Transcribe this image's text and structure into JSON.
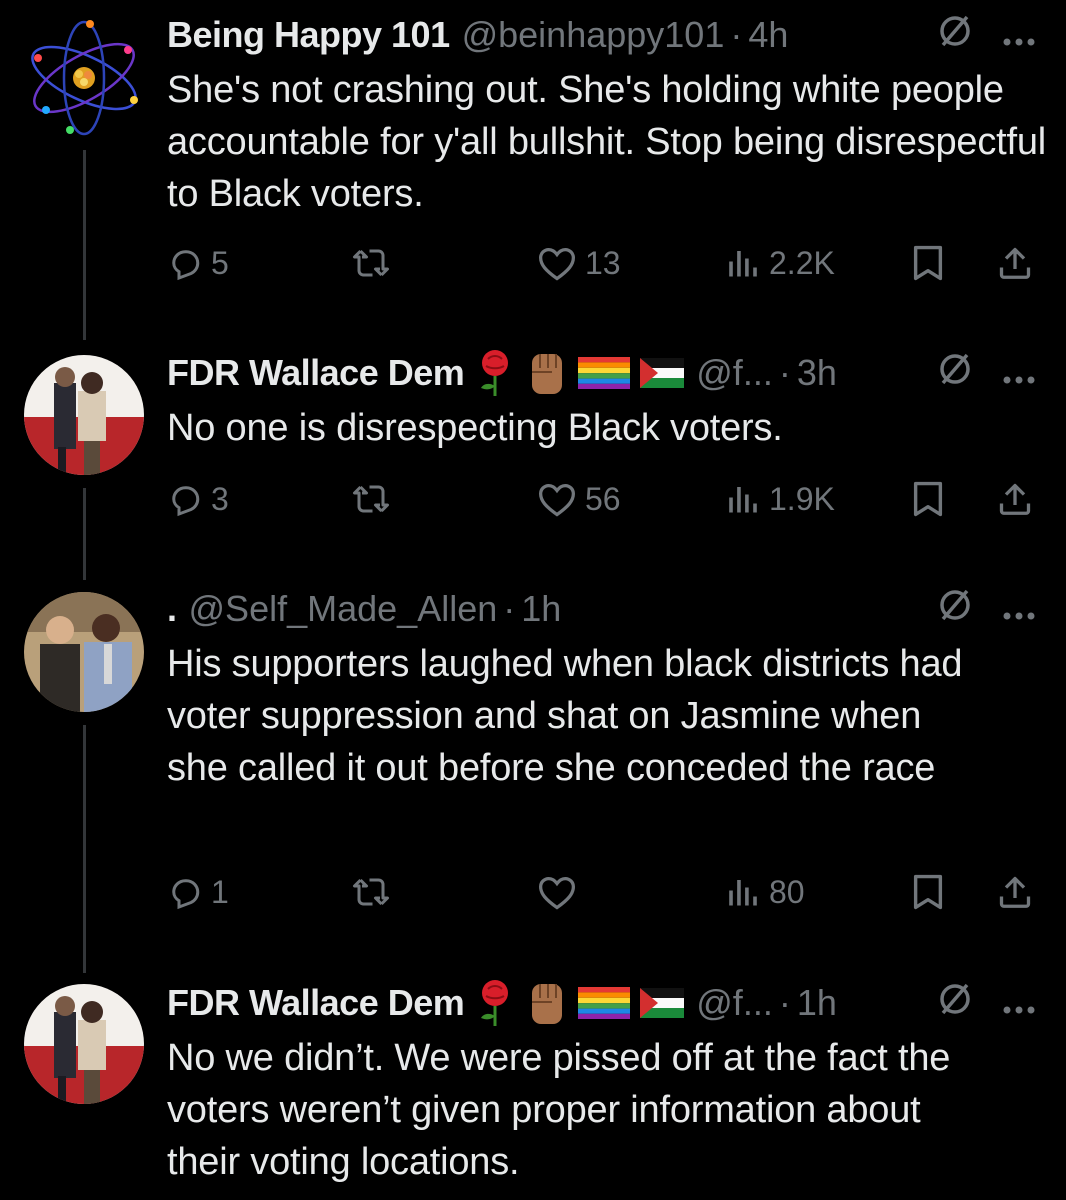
{
  "colors": {
    "background": "#000000",
    "text": "#e7e9ea",
    "muted": "#71767b",
    "thread_line": "#333639"
  },
  "tweets": [
    {
      "name": "Being Happy 101",
      "handle": "@beinhappy101",
      "dot": "·",
      "time": "4h",
      "text": "She's not crashing out. She's holding white people accountable for y'all bullshit. Stop being disrespectful to Black voters.",
      "replies": "5",
      "reposts": "",
      "likes": "13",
      "views": "2.2K",
      "emojis": []
    },
    {
      "name": "FDR Wallace Dem",
      "handle": "@f...",
      "dot": "·",
      "time": "3h",
      "text": "No one is disrespecting Black voters.",
      "replies": "3",
      "reposts": "",
      "likes": "56",
      "views": "1.9K",
      "emojis": [
        "rose-emoji",
        "raised-fist-emoji",
        "rainbow-flag-emoji",
        "palestine-flag-emoji"
      ]
    },
    {
      "name": ".",
      "handle": "@Self_Made_Allen",
      "dot": "·",
      "time": "1h",
      "text": "His supporters laughed when black districts had voter suppression and shat on Jasmine when she called it out before she conceded the race",
      "replies": "1",
      "reposts": "",
      "likes": "",
      "views": "80",
      "emojis": []
    },
    {
      "name": "FDR Wallace Dem",
      "handle": "@f...",
      "dot": "·",
      "time": "1h",
      "text": "No we didn’t. We were pissed off at the fact the voters weren’t given proper information about their voting locations.",
      "emojis": [
        "rose-emoji",
        "raised-fist-emoji",
        "rainbow-flag-emoji",
        "palestine-flag-emoji"
      ]
    }
  ],
  "icons": {
    "reply": "reply-icon",
    "repost": "repost-icon",
    "like": "heart-icon",
    "views": "views-icon",
    "bookmark": "bookmark-icon",
    "share": "share-icon",
    "grok": "slashed-circle-icon",
    "more": "more-dots-icon"
  }
}
